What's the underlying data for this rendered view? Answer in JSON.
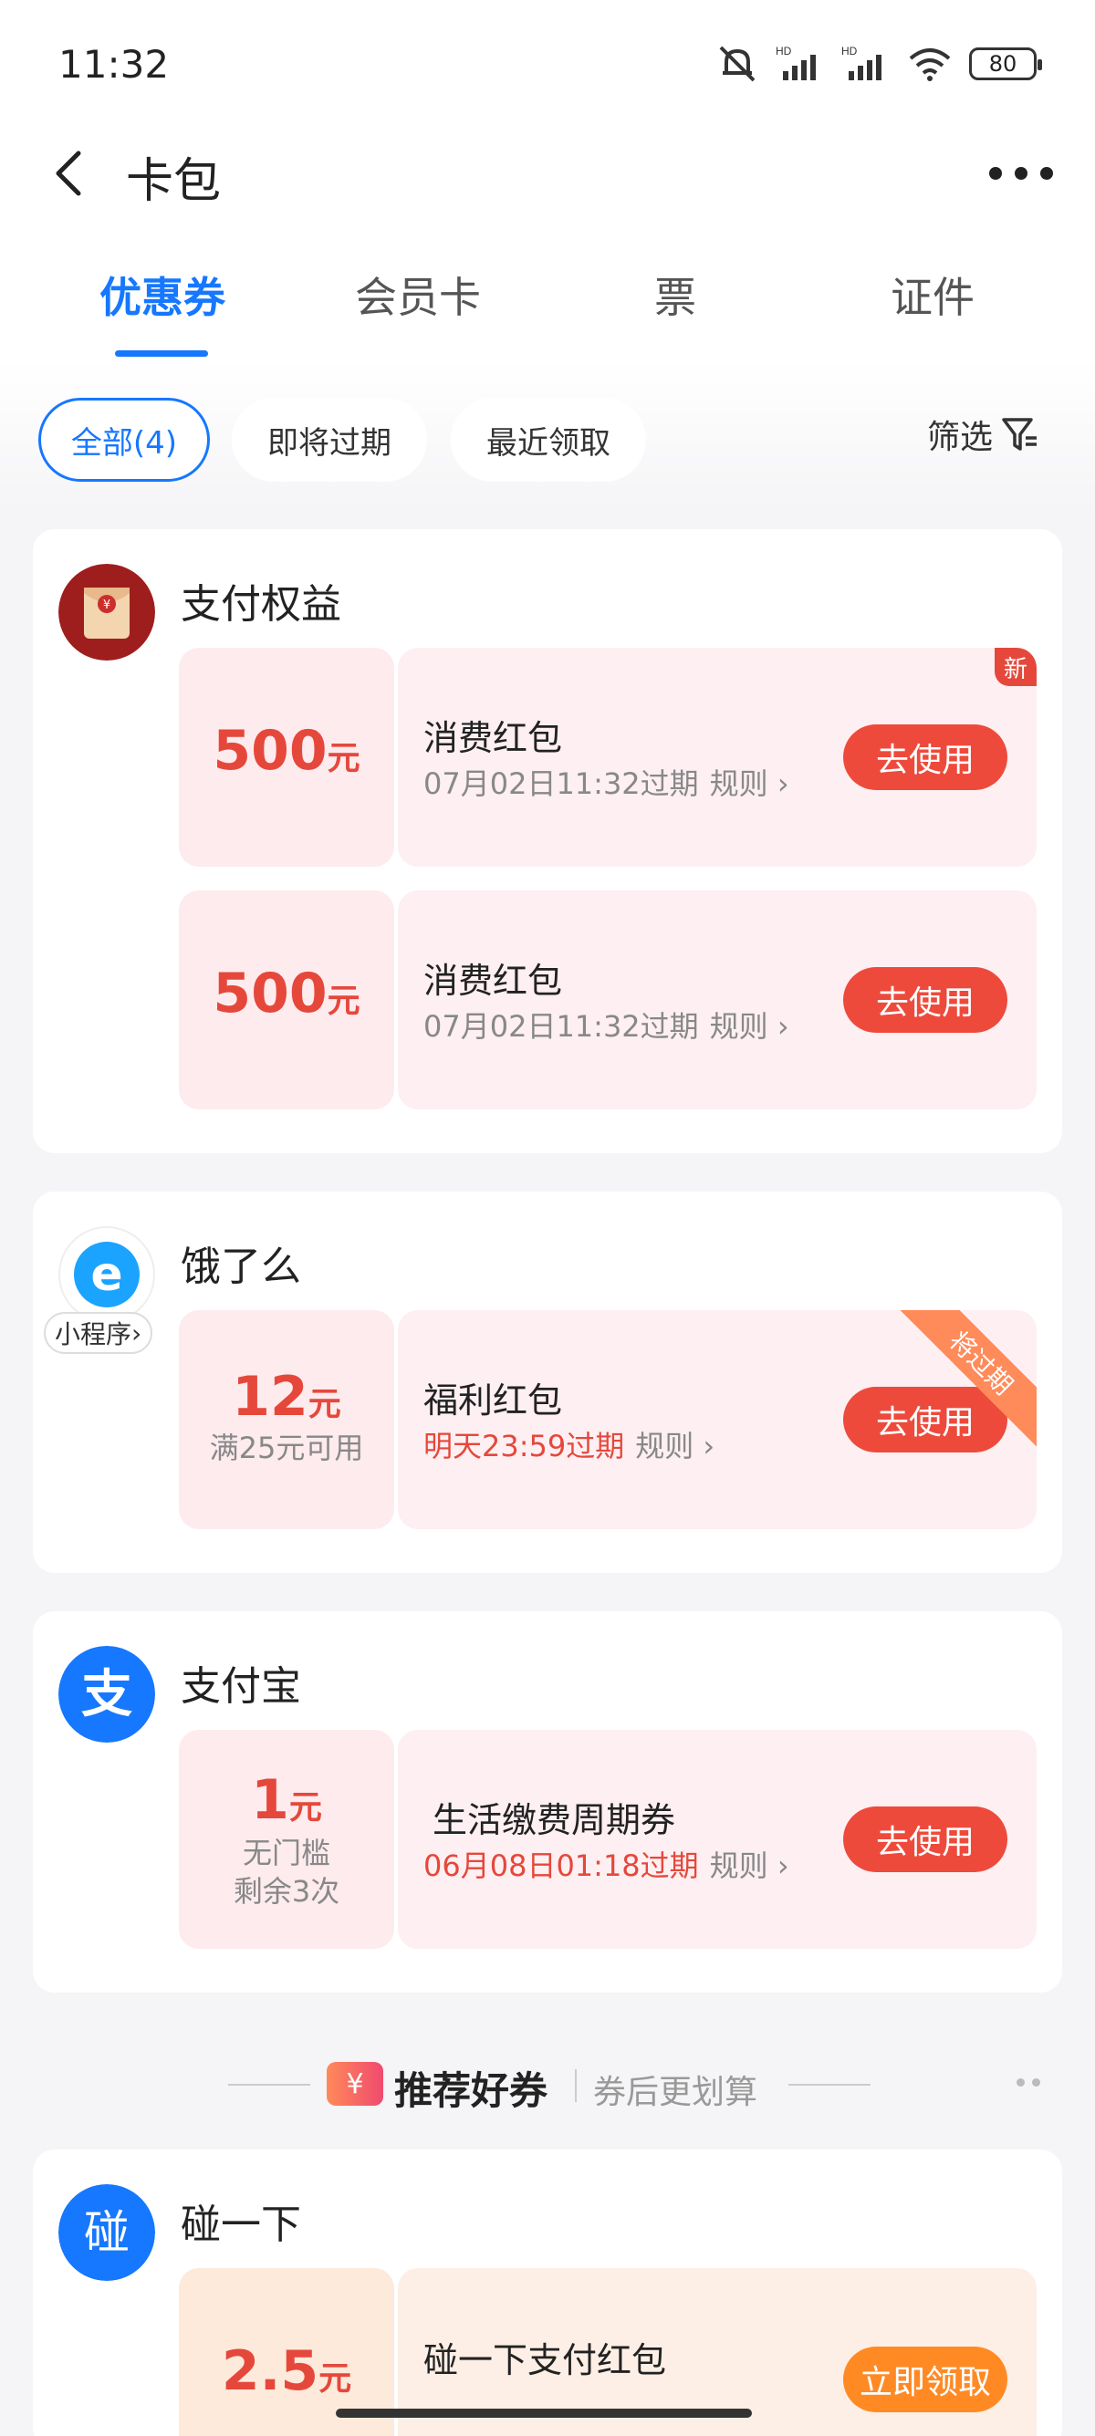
{
  "status": {
    "time": "11:32",
    "battery": "80"
  },
  "nav": {
    "title": "卡包"
  },
  "tabs": [
    "优惠券",
    "会员卡",
    "票",
    "证件"
  ],
  "filters": {
    "all": "全部(4)",
    "expiring": "即将过期",
    "recent": "最近领取",
    "filter": "筛选"
  },
  "groups": [
    {
      "merchant": "支付权益",
      "coupons": [
        {
          "amount": "500",
          "unit": "元",
          "title": "消费红包",
          "expire": "07月02日11:32过期",
          "rule": "规则",
          "button": "去使用",
          "badge": "新"
        },
        {
          "amount": "500",
          "unit": "元",
          "title": "消费红包",
          "expire": "07月02日11:32过期",
          "rule": "规则",
          "button": "去使用"
        }
      ]
    },
    {
      "merchant": "饿了么",
      "tag": "小程序",
      "coupons": [
        {
          "amount": "12",
          "unit": "元",
          "cond1": "满25元可用",
          "title": "福利红包",
          "expire": "明天23:59过期",
          "rule": "规则",
          "button": "去使用",
          "ribbon": "将过期"
        }
      ]
    },
    {
      "merchant": "支付宝",
      "coupons": [
        {
          "amount": "1",
          "unit": "元",
          "cond1": "无门槛",
          "cond2": "剩余3次",
          "title": "生活缴费周期券",
          "expire": "06月08日01:18过期",
          "rule": "规则",
          "button": "去使用"
        }
      ]
    }
  ],
  "recommend": {
    "icon": "¥",
    "title": "推荐好券",
    "subtitle": "券后更划算"
  },
  "recommend_group": {
    "merchant": "碰一下",
    "logo_char": "碰",
    "coupons": [
      {
        "amount": "2.5",
        "unit": "元",
        "title": "碰一下支付红包",
        "button": "立即领取"
      }
    ]
  },
  "colors": {
    "accent": "#1677ff",
    "red": "#e5483b",
    "orange": "#ff8a24"
  },
  "icons": {
    "zhifubao_char": "支",
    "elm_char": "e",
    "hongbao_char": "¥"
  }
}
